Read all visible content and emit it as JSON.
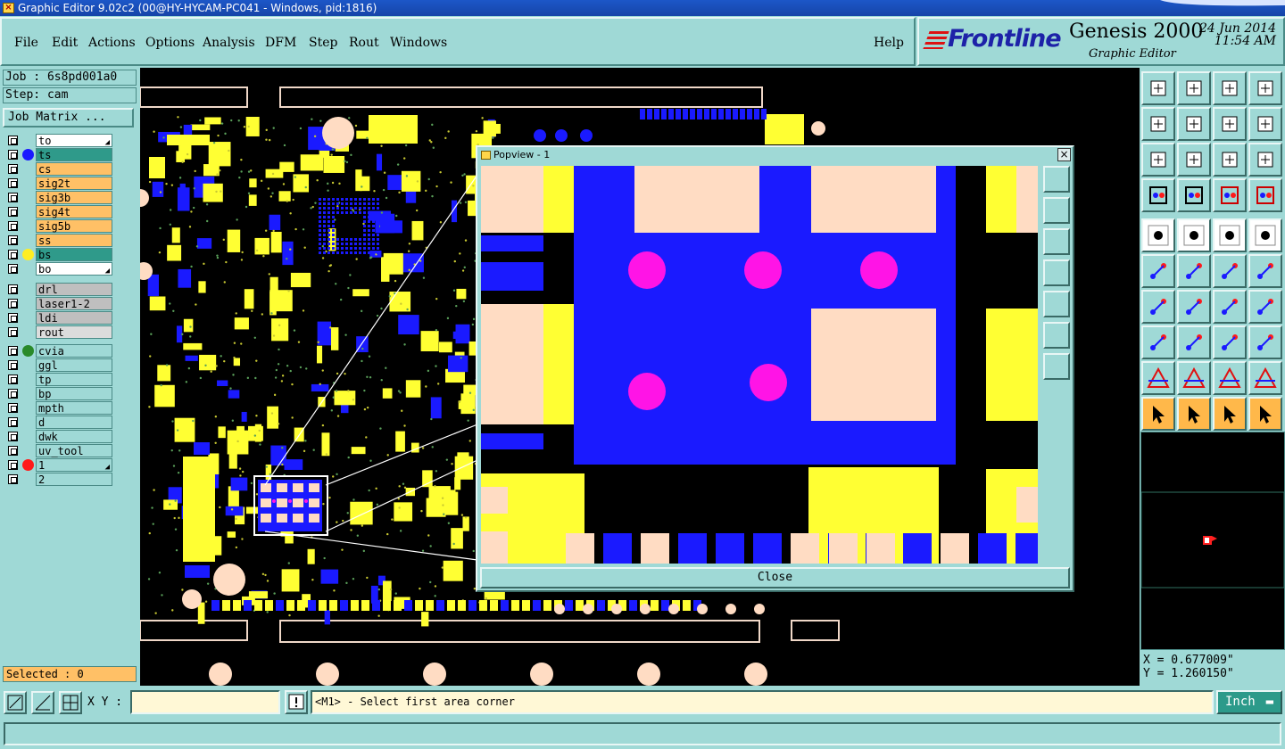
{
  "window": {
    "title": "Graphic Editor 9.02c2 (00@HY-HYCAM-PC041 - Windows, pid:1816)"
  },
  "menu": {
    "items": [
      "File",
      "Edit",
      "Actions",
      "Options",
      "Analysis",
      "DFM",
      "Step",
      "Rout",
      "Windows"
    ],
    "help": "Help"
  },
  "brand": {
    "logo": "Frontline",
    "product": "Genesis 2000",
    "subtitle": "Graphic Editor",
    "date": "24 Jun 2014",
    "time": "11:54 AM"
  },
  "job": {
    "job_label": "Job : 6s8pd001a0",
    "step_label": "Step: cam",
    "matrix_button": "Job Matrix ..."
  },
  "layers": {
    "board": [
      {
        "name": "to",
        "color": "#ffffff",
        "dot": "",
        "pin": true
      },
      {
        "name": "ts",
        "color": "#2f9a8a",
        "dot": "#1a1aff"
      },
      {
        "name": "cs",
        "color": "#ffc066",
        "dot": ""
      },
      {
        "name": "sig2t",
        "color": "#ffc066",
        "dot": ""
      },
      {
        "name": "sig3b",
        "color": "#ffc066",
        "dot": ""
      },
      {
        "name": "sig4t",
        "color": "#ffc066",
        "dot": ""
      },
      {
        "name": "sig5b",
        "color": "#ffc066",
        "dot": ""
      },
      {
        "name": "ss",
        "color": "#ffc066",
        "dot": ""
      },
      {
        "name": "bs",
        "color": "#2f9a8a",
        "dot": "#ffee22"
      },
      {
        "name": "bo",
        "color": "#ffffff",
        "dot": "",
        "pin": true
      }
    ],
    "drill": [
      {
        "name": "drl",
        "color": "#bfbfbf"
      },
      {
        "name": "laser1-2",
        "color": "#bfbfbf"
      },
      {
        "name": "ldi",
        "color": "#bfbfbf"
      },
      {
        "name": "rout",
        "color": "#dcdcdc"
      }
    ],
    "misc": [
      {
        "name": "cvia",
        "color": "#9fd9d6",
        "dot": "#2a8a2a"
      },
      {
        "name": "ggl",
        "color": "#9fd9d6",
        "dot": ""
      },
      {
        "name": "tp",
        "color": "#9fd9d6",
        "dot": ""
      },
      {
        "name": "bp",
        "color": "#9fd9d6",
        "dot": ""
      },
      {
        "name": "mpth",
        "color": "#9fd9d6",
        "dot": ""
      },
      {
        "name": "d",
        "color": "#9fd9d6",
        "dot": ""
      },
      {
        "name": "dwk",
        "color": "#9fd9d6",
        "dot": ""
      },
      {
        "name": "uv_tool",
        "color": "#9fd9d6",
        "dot": ""
      },
      {
        "name": "1",
        "color": "#9fd9d6",
        "dot": "#ff1a1a",
        "pin": true
      },
      {
        "name": "2",
        "color": "#9fd9d6",
        "dot": ""
      }
    ]
  },
  "selected": "Selected : 0",
  "popview": {
    "title": "Popview - 1",
    "close_label": "Close"
  },
  "coords": {
    "x": "X = 0.677009\"",
    "y": "Y = 1.260150\""
  },
  "bottom": {
    "xy_label": "X Y :",
    "xy_value": "",
    "prompt": "<M1> - Select first area corner",
    "units": "Inch"
  },
  "colors": {
    "pad_yellow": "#ffff33",
    "pad_blue": "#1a1aff",
    "pad_peach": "#ffdcc3",
    "via_magenta": "#ff14e6",
    "panel_teal": "#9fd9d6"
  }
}
